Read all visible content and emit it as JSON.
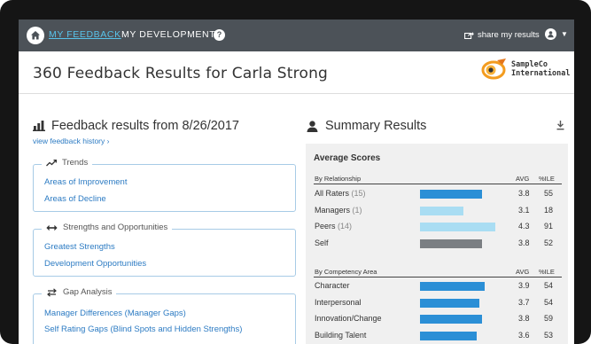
{
  "nav": {
    "items": [
      {
        "label": "MY FEEDBACK",
        "active": true
      },
      {
        "label": "MY DEVELOPMENT",
        "active": false
      }
    ],
    "share_label": "share my results"
  },
  "header": {
    "title": "360 Feedback Results for Carla Strong",
    "brand_line1": "SampleCo",
    "brand_line2": "International"
  },
  "feedback": {
    "title": "Feedback results from 8/26/2017",
    "history_link": "view feedback history ›",
    "groups": [
      {
        "title": "Trends",
        "icon": "trend-icon",
        "links": [
          "Areas of Improvement",
          "Areas of Decline"
        ]
      },
      {
        "title": "Strengths and Opportunities",
        "icon": "arrows-icon",
        "links": [
          "Greatest Strengths",
          "Development Opportunities"
        ]
      },
      {
        "title": "Gap Analysis",
        "icon": "gap-icon",
        "links": [
          "Manager Differences (Manager Gaps)",
          "Self Rating Gaps (Blind Spots and Hidden Strengths)"
        ]
      }
    ]
  },
  "summary": {
    "title": "Summary Results",
    "avg_scores_label": "Average Scores",
    "avg_header": "AVG",
    "ile_header": "%ILE",
    "relationship": {
      "label": "By Relationship",
      "rows": [
        {
          "name": "All Raters",
          "count": "(15)",
          "avg": "3.8",
          "ile": "55",
          "avg_value": 3.8,
          "color": "#2b8fd6"
        },
        {
          "name": "Managers",
          "count": "(1)",
          "avg": "3.1",
          "ile": "18",
          "avg_value": 3.1,
          "color": "#a9ddf3"
        },
        {
          "name": "Peers",
          "count": "(14)",
          "avg": "4.3",
          "ile": "91",
          "avg_value": 4.3,
          "color": "#a9ddf3"
        },
        {
          "name": "Self",
          "count": "",
          "avg": "3.8",
          "ile": "52",
          "avg_value": 3.8,
          "color": "#7b7f83"
        }
      ]
    },
    "competency": {
      "label": "By Competency Area",
      "rows": [
        {
          "name": "Character",
          "count": "",
          "avg": "3.9",
          "ile": "54",
          "avg_value": 3.9,
          "color": "#2b8fd6"
        },
        {
          "name": "Interpersonal",
          "count": "",
          "avg": "3.7",
          "ile": "54",
          "avg_value": 3.7,
          "color": "#2b8fd6"
        },
        {
          "name": "Innovation/Change",
          "count": "",
          "avg": "3.8",
          "ile": "59",
          "avg_value": 3.8,
          "color": "#2b8fd6"
        },
        {
          "name": "Building Talent",
          "count": "",
          "avg": "3.6",
          "ile": "53",
          "avg_value": 3.6,
          "color": "#2b8fd6"
        }
      ]
    },
    "scale_max": 5
  }
}
